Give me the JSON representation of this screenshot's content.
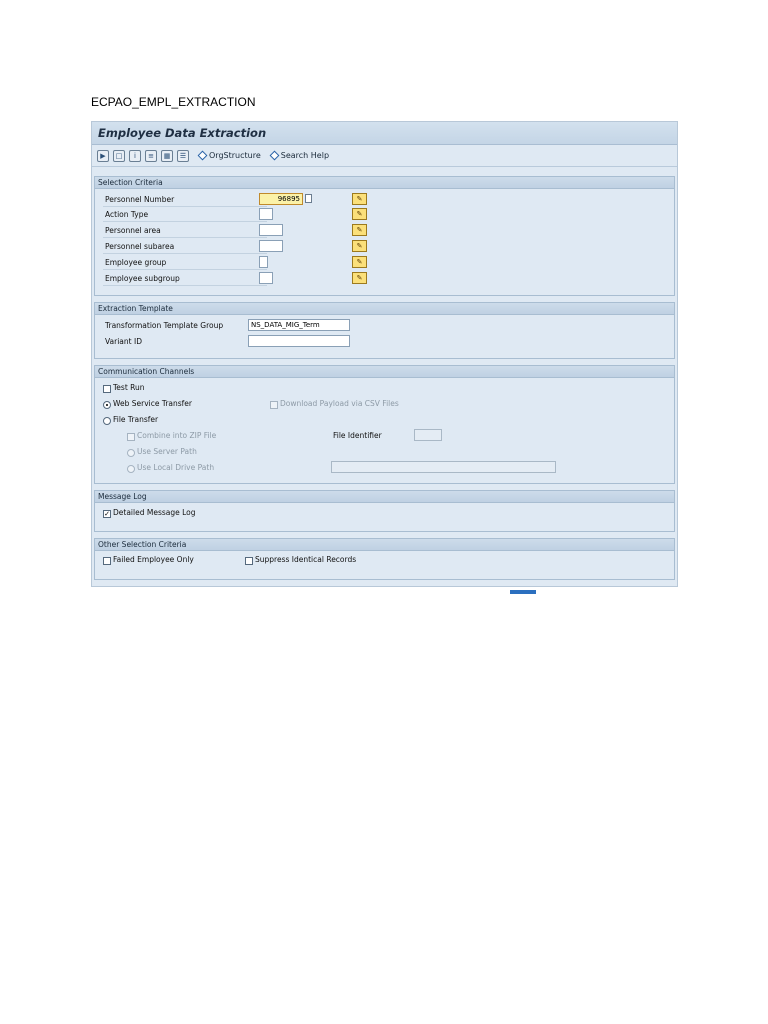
{
  "doc": {
    "title": "ECPAO_EMPL_EXTRACTION"
  },
  "window": {
    "title": "Employee Data Extraction"
  },
  "toolbar": {
    "icons": [
      "execute-icon",
      "copy-variant-icon",
      "info-icon",
      "print-icon",
      "layout-icon",
      "list-icon"
    ],
    "orgstructure_label": "OrgStructure",
    "searchhelp_label": "Search Help"
  },
  "selection": {
    "header": "Selection Criteria",
    "rows": [
      {
        "label": "Personnel Number",
        "value": "96895"
      },
      {
        "label": "Action Type",
        "value": ""
      },
      {
        "label": "Personnel area",
        "value": ""
      },
      {
        "label": "Personnel subarea",
        "value": ""
      },
      {
        "label": "Employee group",
        "value": ""
      },
      {
        "label": "Employee subgroup",
        "value": ""
      }
    ]
  },
  "template": {
    "header": "Extraction Template",
    "group_label": "Transformation Template Group",
    "group_value": "NS_DATA_MIG_Term",
    "variant_label": "Variant ID",
    "variant_value": ""
  },
  "channels": {
    "header": "Communication Channels",
    "test_run": "Test Run",
    "web_service": "Web Service Transfer",
    "download_csv": "Download Payload via CSV Files",
    "file_transfer": "File Transfer",
    "combine_zip": "Combine into ZIP File",
    "file_identifier": "File Identifier",
    "server_path": "Use Server Path",
    "local_path": "Use Local Drive Path"
  },
  "message_log": {
    "header": "Message Log",
    "detailed": "Detailed Message Log"
  },
  "other": {
    "header": "Other Selection Criteria",
    "failed_only": "Failed Employee Only",
    "suppress": "Suppress Identical Records"
  }
}
